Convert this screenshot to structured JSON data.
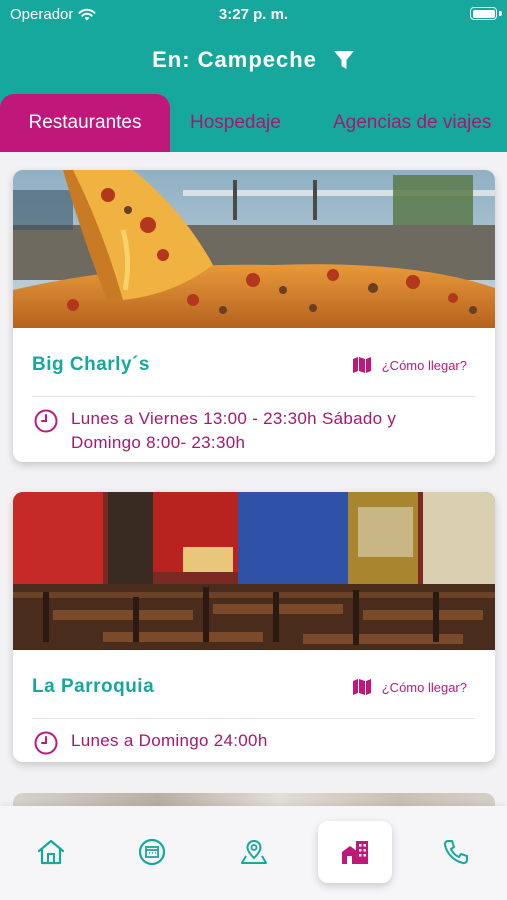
{
  "status_bar": {
    "carrier": "Operador",
    "time": "3:27 p. m."
  },
  "header": {
    "title": "En: Campeche",
    "filter_icon": "filter-icon"
  },
  "tabs": [
    {
      "label": "Restaurantes",
      "active": true
    },
    {
      "label": "Hospedaje",
      "active": false
    },
    {
      "label": "Agencias de viajes",
      "active": false
    }
  ],
  "restaurants": [
    {
      "name": "Big Charly´s",
      "directions_label": "¿Cómo llegar?",
      "hours": "Lunes a Viernes 13:00 - 23:30h   Sábado y Domingo 8:00- 23:30h"
    },
    {
      "name": "La Parroquia",
      "directions_label": "¿Cómo llegar?",
      "hours": "Lunes a Domingo 24:00h"
    }
  ],
  "bottom_nav": [
    {
      "icon": "home-icon",
      "active": false
    },
    {
      "icon": "calendar-icon",
      "active": false
    },
    {
      "icon": "map-pin-icon",
      "active": false
    },
    {
      "icon": "buildings-icon",
      "active": true
    },
    {
      "icon": "phone-icon",
      "active": false
    }
  ],
  "colors": {
    "teal": "#17a89d",
    "magenta": "#c0177a",
    "purple_text": "#a51870",
    "background": "#f2f1f4"
  }
}
